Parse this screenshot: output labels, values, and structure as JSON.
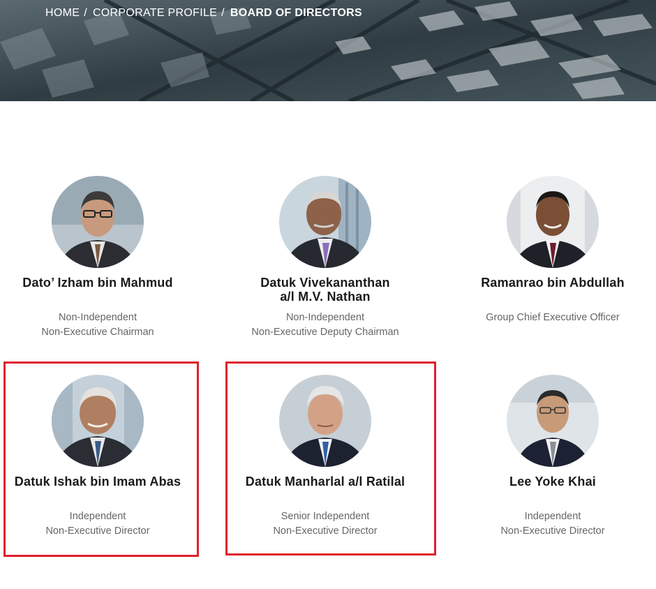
{
  "breadcrumb": {
    "home": "HOME",
    "sep1": "/",
    "profile": "CORPORATE PROFILE",
    "sep2": "/",
    "current": "BOARD OF DIRECTORS"
  },
  "directors": [
    {
      "name_line1": "Dato’ Izham bin Mahmud",
      "name_line2": "",
      "role_line1": "Non-Independent",
      "role_line2": "Non-Executive Chairman"
    },
    {
      "name_line1": "Datuk Vivekananthan",
      "name_line2": "a/l M.V. Nathan",
      "role_line1": "Non-Independent",
      "role_line2": "Non-Executive Deputy Chairman"
    },
    {
      "name_line1": "Ramanrao bin Abdullah",
      "name_line2": "",
      "role_line1": "Group Chief Executive Officer",
      "role_line2": ""
    },
    {
      "name_line1": "Datuk Ishak bin Imam Abas",
      "name_line2": "",
      "role_line1": "Independent",
      "role_line2": "Non-Executive Director"
    },
    {
      "name_line1": "Datuk Manharlal a/l Ratilal",
      "name_line2": "",
      "role_line1": "Senior Independent",
      "role_line2": "Non-Executive Director"
    },
    {
      "name_line1": "Lee Yoke Khai",
      "name_line2": "",
      "role_line1": "Independent",
      "role_line2": "Non-Executive Director"
    }
  ],
  "colors": {
    "highlight_border": "#e0202c",
    "name_text": "#1a1a1a",
    "role_text": "#666666"
  }
}
